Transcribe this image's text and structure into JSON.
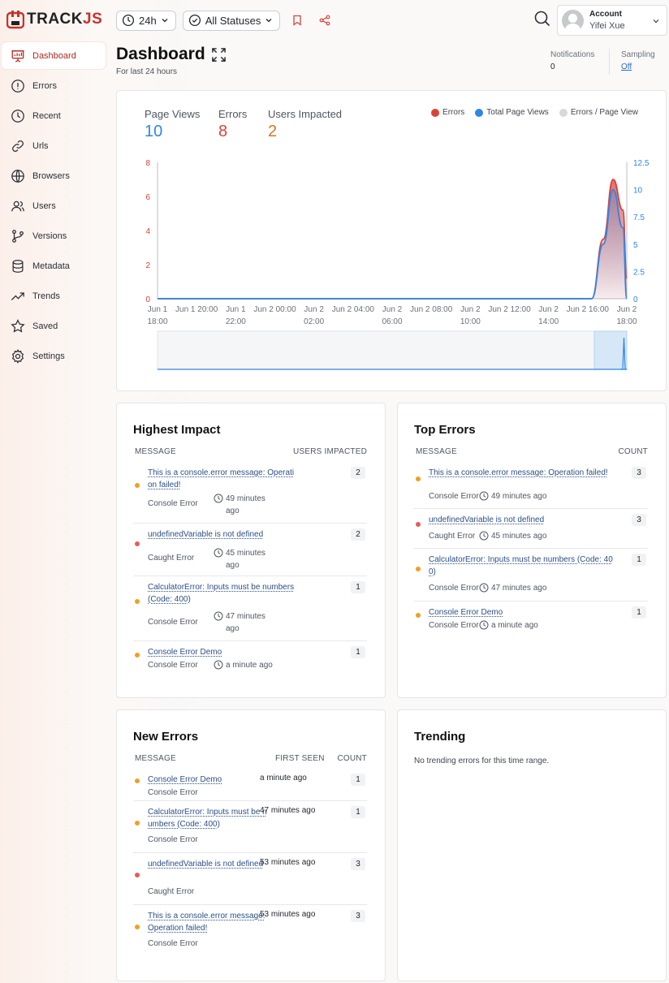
{
  "brand": {
    "logo_text_main": "TRACK",
    "logo_text_accent": "JS"
  },
  "sidebar": {
    "items": [
      {
        "label": "Dashboard",
        "icon": "presentation-chart-icon",
        "active": true
      },
      {
        "label": "Errors",
        "icon": "alert-circle-icon"
      },
      {
        "label": "Recent",
        "icon": "clock-icon"
      },
      {
        "label": "Urls",
        "icon": "link-icon"
      },
      {
        "label": "Browsers",
        "icon": "globe-icon"
      },
      {
        "label": "Users",
        "icon": "users-icon"
      },
      {
        "label": "Versions",
        "icon": "git-branch-icon"
      },
      {
        "label": "Metadata",
        "icon": "database-icon"
      },
      {
        "label": "Trends",
        "icon": "trending-up-icon"
      },
      {
        "label": "Saved",
        "icon": "star-icon"
      },
      {
        "label": "Settings",
        "icon": "gear-icon"
      }
    ]
  },
  "toolbar": {
    "time_range": "24h",
    "status_filter": "All Statuses"
  },
  "account": {
    "label": "Account",
    "name": "Yifei Xue"
  },
  "header": {
    "title": "Dashboard",
    "subtitle": "For last 24 hours"
  },
  "meta": {
    "notifications_label": "Notifications",
    "notifications_value": "0",
    "sampling_label": "Sampling",
    "sampling_value": "Off"
  },
  "stats": {
    "page_views_label": "Page Views",
    "page_views": "10",
    "errors_label": "Errors",
    "errors": "8",
    "users_label": "Users Impacted",
    "users": "2"
  },
  "colors": {
    "errors": "#d9423a",
    "page_views": "#2f86e6",
    "users": "#d9761c",
    "ratio": "#d6d9de",
    "orange_dot": "#f0a020",
    "red_dot": "#e85a5a"
  },
  "chart_data": {
    "type": "area",
    "legend": [
      "Errors",
      "Total Page Views",
      "Errors / Page View"
    ],
    "x_ticks": [
      [
        "Jun 1",
        "18:00"
      ],
      [
        "Jun 1 20:00",
        ""
      ],
      [
        "Jun 1",
        "22:00"
      ],
      [
        "Jun 2 00:00",
        ""
      ],
      [
        "Jun 2",
        "02:00"
      ],
      [
        "Jun 2 04:00",
        ""
      ],
      [
        "Jun 2",
        "06:00"
      ],
      [
        "Jun 2 08:00",
        ""
      ],
      [
        "Jun 2",
        "10:00"
      ],
      [
        "Jun 2 12:00",
        ""
      ],
      [
        "Jun 2",
        "14:00"
      ],
      [
        "Jun 2 16:00",
        ""
      ],
      [
        "Jun 2",
        "18:00"
      ]
    ],
    "y_left": {
      "ticks": [
        "0",
        "2",
        "4",
        "6",
        "8"
      ],
      "range": [
        0,
        8
      ]
    },
    "y_right": {
      "ticks": [
        "0",
        "2.5",
        "5",
        "7.5",
        "10",
        "12.5"
      ],
      "range": [
        0,
        12.5
      ]
    },
    "xlim_hours": [
      0,
      24
    ],
    "series": [
      {
        "name": "Errors",
        "axis": "left",
        "points": [
          [
            0,
            0
          ],
          [
            22.2,
            0
          ],
          [
            22.8,
            3.5
          ],
          [
            23.3,
            7
          ],
          [
            23.8,
            5.2
          ],
          [
            24,
            1.2
          ]
        ]
      },
      {
        "name": "Total Page Views",
        "axis": "right",
        "points": [
          [
            0,
            0
          ],
          [
            22.2,
            0
          ],
          [
            22.8,
            5
          ],
          [
            23.3,
            10
          ],
          [
            23.8,
            6.5
          ],
          [
            24,
            0
          ]
        ]
      }
    ]
  },
  "highest_impact": {
    "title": "Highest Impact",
    "col_message": "MESSAGE",
    "col_value": "USERS IMPACTED",
    "rows": [
      {
        "msg": "This is a console.error message: Operation failed!",
        "type": "Console Error",
        "ago": "49 minutes ago",
        "value": "2",
        "level": "orange"
      },
      {
        "msg": "undefinedVariable is not defined",
        "type": "Caught Error",
        "ago": "45 minutes ago",
        "value": "2",
        "level": "red"
      },
      {
        "msg": "CalculatorError: Inputs must be numbers (Code: 400)",
        "type": "Console Error",
        "ago": "47 minutes ago",
        "value": "1",
        "level": "orange"
      },
      {
        "msg": "Console Error Demo",
        "type": "Console Error",
        "ago": "a minute ago",
        "value": "1",
        "level": "orange"
      }
    ]
  },
  "top_errors": {
    "title": "Top Errors",
    "col_message": "MESSAGE",
    "col_value": "COUNT",
    "rows": [
      {
        "msg": "This is a console.error message: Operation failed!",
        "type": "Console Error",
        "ago": "49 minutes ago",
        "value": "3",
        "level": "orange"
      },
      {
        "msg": "undefinedVariable is not defined",
        "type": "Caught Error",
        "ago": "45 minutes ago",
        "value": "3",
        "level": "red"
      },
      {
        "msg": "CalculatorError: Inputs must be numbers (Code: 400)",
        "type": "Console Error",
        "ago": "47 minutes ago",
        "value": "1",
        "level": "orange"
      },
      {
        "msg": "Console Error Demo",
        "type": "Console Error",
        "ago": "a minute ago",
        "value": "1",
        "level": "orange"
      }
    ]
  },
  "new_errors": {
    "title": "New Errors",
    "col_message": "MESSAGE",
    "col_first_seen": "FIRST SEEN",
    "col_count": "COUNT",
    "rows": [
      {
        "msg": "Console Error Demo",
        "type": "Console Error",
        "first_seen": "a minute ago",
        "count": "1",
        "level": "orange"
      },
      {
        "msg": "CalculatorError: Inputs must be numbers (Code: 400)",
        "type": "Console Error",
        "first_seen": "47 minutes ago",
        "count": "1",
        "level": "orange"
      },
      {
        "msg": "undefinedVariable is not defined",
        "type": "Caught Error",
        "first_seen": "53 minutes ago",
        "count": "3",
        "level": "red"
      },
      {
        "msg": "This is a console.error message: Operation failed!",
        "type": "Console Error",
        "first_seen": "53 minutes ago",
        "count": "3",
        "level": "orange"
      }
    ]
  },
  "trending": {
    "title": "Trending",
    "empty": "No trending errors for this time range."
  }
}
